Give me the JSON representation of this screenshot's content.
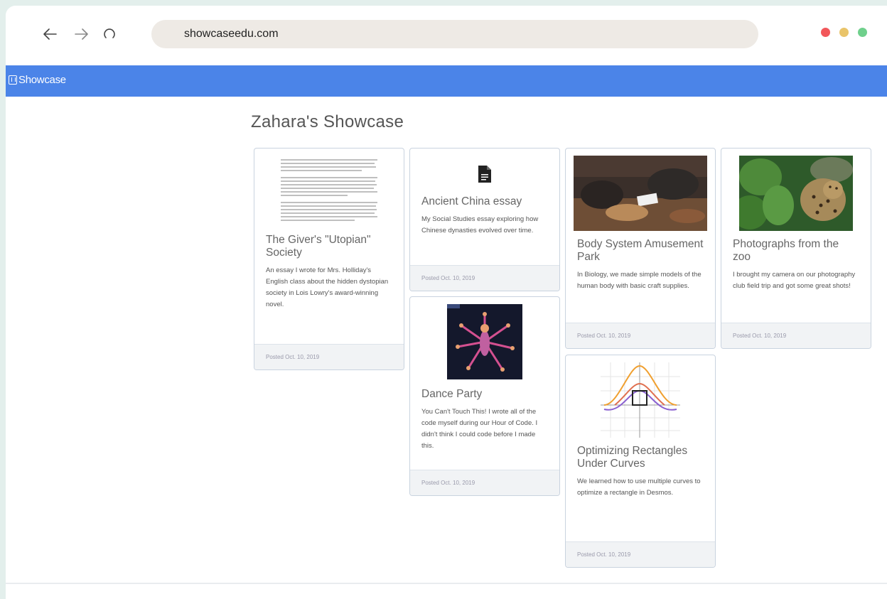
{
  "browser": {
    "url": "showcaseedu.com"
  },
  "app": {
    "brand": "Showcase"
  },
  "page": {
    "title": "Zahara's Showcase"
  },
  "cards": [
    {
      "title": "The Giver's \"Utopian\" Society",
      "description": "An essay I wrote for Mrs. Holliday's English class about the hidden dystopian society in Lois Lowry's award-winning novel.",
      "posted": "Posted Oct. 10, 2019"
    },
    {
      "title": "Ancient China essay",
      "description": "My Social Studies essay exploring how Chinese dynasties evolved over time.",
      "posted": "Posted Oct. 10, 2019"
    },
    {
      "title": "Body System Amusement Park",
      "description": "In Biology, we made simple models of the human body with basic craft supplies.",
      "posted": "Posted Oct. 10, 2019"
    },
    {
      "title": "Photographs from the zoo",
      "description": "I brought my camera on our photography club field trip and got some great shots!",
      "posted": "Posted Oct. 10, 2019"
    },
    {
      "title": "Dance Party",
      "description": "You Can't Touch This! I wrote all of the code myself during our Hour of Code. I didn't think I could code before I made this.",
      "posted": "Posted Oct. 10, 2019"
    },
    {
      "title": "Optimizing Rectangles Under Curves",
      "description": "We learned how to use multiple curves to optimize a rectangle in Desmos.",
      "posted": "Posted Oct. 10, 2019"
    }
  ],
  "colors": {
    "appbar": "#4b84e8",
    "dot_red": "#f2575a",
    "dot_yellow": "#e9c46a",
    "dot_green": "#6fd08c"
  }
}
